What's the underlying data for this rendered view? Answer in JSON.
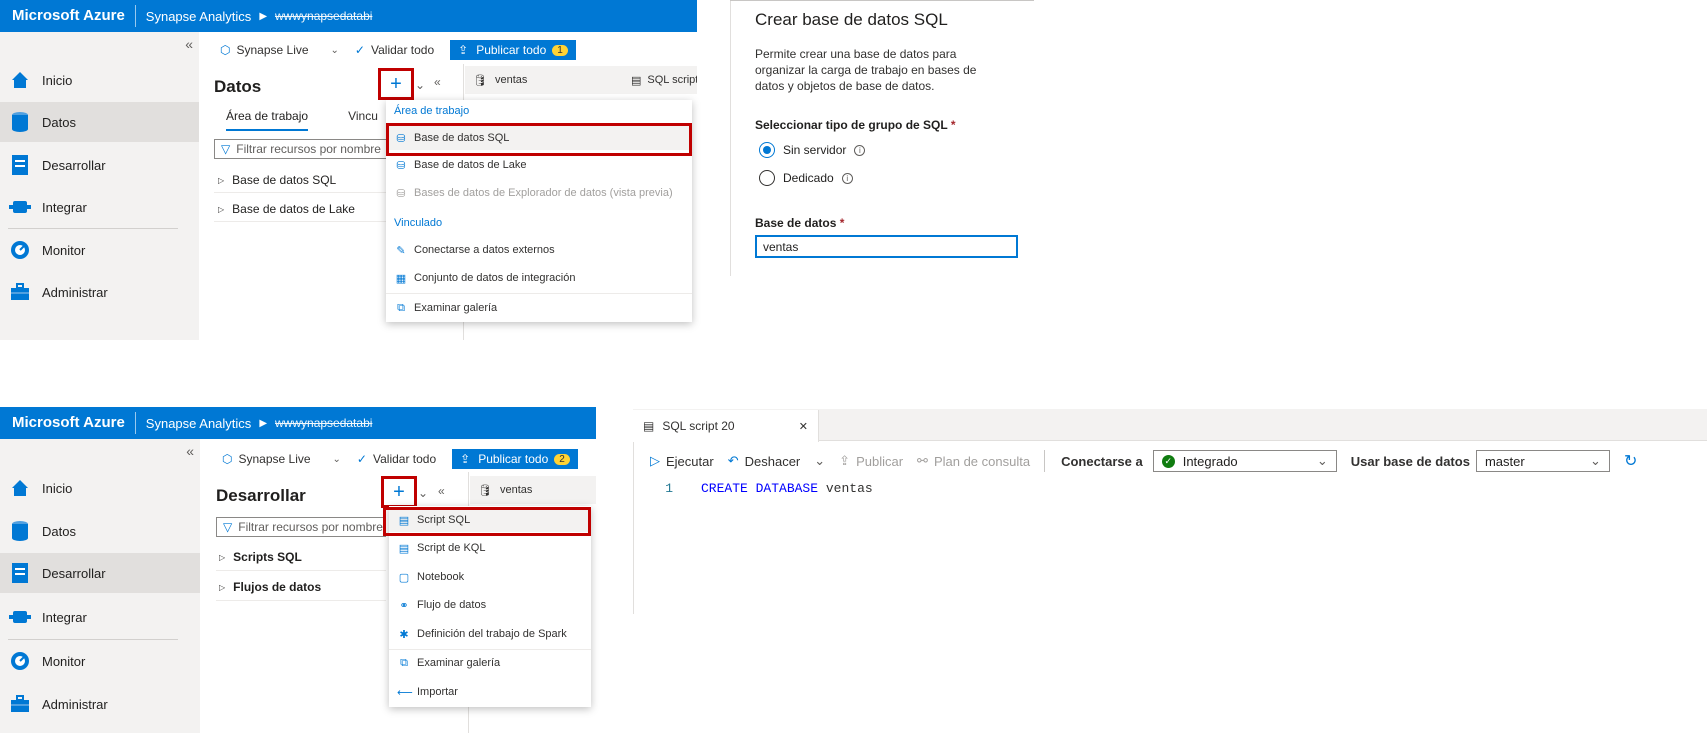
{
  "panel1": {
    "topbar": {
      "brand": "Microsoft Azure",
      "service": "Synapse Analytics",
      "workspace": "wwwynapsedatabi"
    },
    "collapse": "«",
    "nav": [
      {
        "label": "Inicio",
        "icon": "home-icon"
      },
      {
        "label": "Datos",
        "icon": "database-icon",
        "active": true
      },
      {
        "label": "Desarrollar",
        "icon": "document-icon"
      },
      {
        "label": "Integrar",
        "icon": "pipeline-icon"
      },
      {
        "label": "Monitor",
        "icon": "monitor-icon"
      },
      {
        "label": "Administrar",
        "icon": "toolbox-icon"
      }
    ],
    "toolbar": {
      "live": "Synapse Live",
      "validate": "Validar todo",
      "publish": "Publicar todo",
      "publish_count": "1"
    },
    "title": "Datos",
    "tabs": [
      "Área de trabajo",
      "Vincu"
    ],
    "filter_placeholder": "Filtrar recursos por nombre",
    "tree": [
      "Base de datos SQL",
      "Base de datos de Lake"
    ],
    "doc_tabs": [
      "ventas",
      "SQL script"
    ],
    "menu": {
      "header1": "Área de trabajo",
      "items1": [
        "Base de datos SQL",
        "Base de datos de Lake",
        "Bases de datos de Explorador de datos (vista previa)"
      ],
      "header2": "Vinculado",
      "items2": [
        "Conectarse a datos externos",
        "Conjunto de datos de integración"
      ],
      "gallery": "Examinar galería"
    }
  },
  "form": {
    "title": "Crear base de datos SQL",
    "description": "Permite crear una base de datos para organizar la carga de trabajo en bases de datos y objetos de base de datos.",
    "pool_label": "Seleccionar tipo de grupo de SQL",
    "options": [
      "Sin servidor",
      "Dedicado"
    ],
    "db_label": "Base de datos",
    "db_value": "ventas",
    "required": "*"
  },
  "panel2": {
    "topbar": {
      "brand": "Microsoft Azure",
      "service": "Synapse Analytics",
      "workspace": "wwwynapsedatabi"
    },
    "collapse": "«",
    "nav": [
      {
        "label": "Inicio",
        "icon": "home-icon"
      },
      {
        "label": "Datos",
        "icon": "database-icon"
      },
      {
        "label": "Desarrollar",
        "icon": "document-icon",
        "active": true
      },
      {
        "label": "Integrar",
        "icon": "pipeline-icon"
      },
      {
        "label": "Monitor",
        "icon": "monitor-icon"
      },
      {
        "label": "Administrar",
        "icon": "toolbox-icon"
      }
    ],
    "toolbar": {
      "live": "Synapse Live",
      "validate": "Validar todo",
      "publish": "Publicar todo",
      "publish_count": "2"
    },
    "title": "Desarrollar",
    "filter_placeholder": "Filtrar recursos por nombre",
    "tree": [
      "Scripts SQL",
      "Flujos de datos"
    ],
    "doc_tab": "ventas",
    "menu": {
      "items": [
        "Script SQL",
        "Script de KQL",
        "Notebook",
        "Flujo de datos",
        "Definición del trabajo de Spark"
      ],
      "gallery": "Examinar galería",
      "import": "Importar"
    }
  },
  "editor": {
    "tab": "SQL script 20",
    "close": "✕",
    "run": "Ejecutar",
    "undo": "Deshacer",
    "publish": "Publicar",
    "plan": "Plan de consulta",
    "connect_label": "Conectarse a",
    "connect_value": "Integrado",
    "db_label": "Usar base de datos",
    "db_value": "master",
    "line_no": "1",
    "code_kw1": "CREATE",
    "code_kw2": "DATABASE",
    "code_name": "ventas"
  }
}
